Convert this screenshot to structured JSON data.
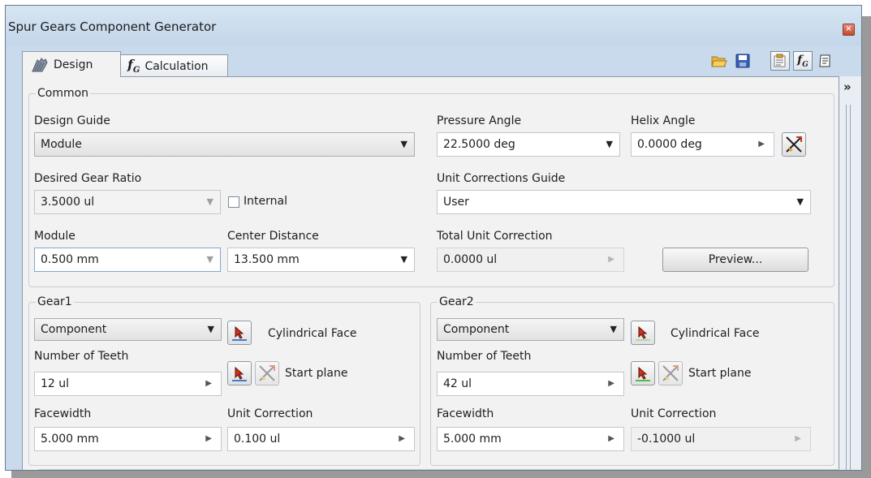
{
  "window": {
    "title": "Spur Gears Component Generator"
  },
  "tabs": [
    {
      "label": "Design",
      "icon": "gear-teeth-icon",
      "active": true
    },
    {
      "label": "Calculation",
      "icon": "fx-calc-icon",
      "active": false
    }
  ],
  "toolbar": [
    "open-folder-icon",
    "save-icon",
    "properties-icon",
    "fx-calc-icon",
    "notes-icon"
  ],
  "common": {
    "title": "Common",
    "design_guide_label": "Design Guide",
    "design_guide_value": "Module",
    "pressure_angle_label": "Pressure Angle",
    "pressure_angle_value": "22.5000 deg",
    "helix_angle_label": "Helix Angle",
    "helix_angle_value": "0.0000 deg",
    "gear_ratio_label": "Desired Gear Ratio",
    "gear_ratio_value": "3.5000 ul",
    "internal_label": "Internal",
    "internal_checked": false,
    "unit_corr_guide_label": "Unit Corrections Guide",
    "unit_corr_guide_value": "User",
    "module_label": "Module",
    "module_value": "0.500 mm",
    "center_distance_label": "Center Distance",
    "center_distance_value": "13.500 mm",
    "total_unit_corr_label": "Total Unit Correction",
    "total_unit_corr_value": "0.0000 ul",
    "preview_label": "Preview..."
  },
  "gear1": {
    "title": "Gear1",
    "type_value": "Component",
    "face_label": "Cylindrical Face",
    "teeth_label": "Number of Teeth",
    "teeth_value": "12 ul",
    "plane_label": "Start plane",
    "facewidth_label": "Facewidth",
    "facewidth_value": "5.000 mm",
    "unit_corr_label": "Unit Correction",
    "unit_corr_value": "0.100 ul"
  },
  "gear2": {
    "title": "Gear2",
    "type_value": "Component",
    "face_label": "Cylindrical Face",
    "teeth_label": "Number of Teeth",
    "teeth_value": "42 ul",
    "plane_label": "Start plane",
    "facewidth_label": "Facewidth",
    "facewidth_value": "5.000 mm",
    "unit_corr_label": "Unit Correction",
    "unit_corr_value": "-0.1000 ul"
  },
  "colors": {
    "title_bar": "#c8daec",
    "panel": "#f2f2f2",
    "selected_underline_gear1": "#3a7fd5",
    "selected_underline_gear2": "#49c04a"
  }
}
